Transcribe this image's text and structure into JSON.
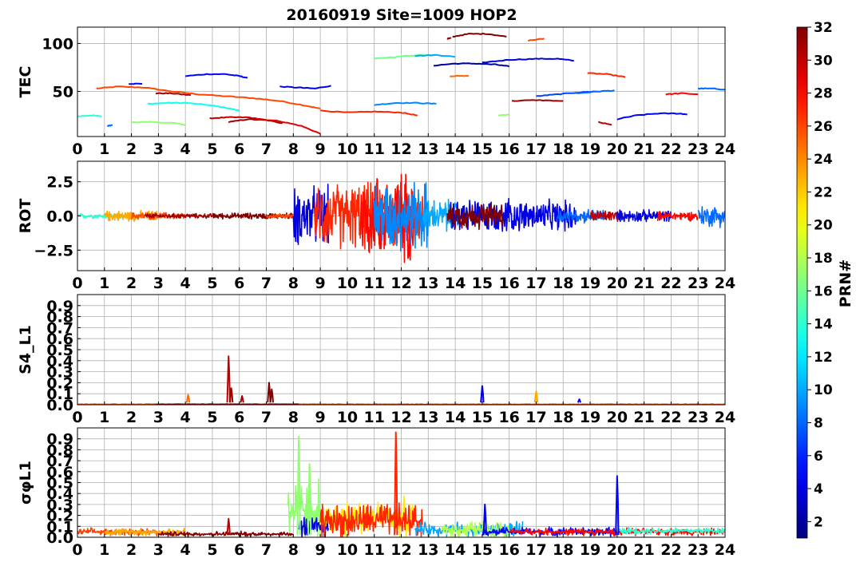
{
  "figure_title": "20160919 Site=1009 HOP2",
  "colorbar": {
    "label": "PRN#",
    "min": 1,
    "max": 32,
    "ticks": [
      2,
      4,
      6,
      8,
      10,
      12,
      14,
      16,
      18,
      20,
      22,
      24,
      26,
      28,
      30,
      32
    ],
    "colormap": "jet"
  },
  "chart_data": [
    {
      "type": "line",
      "panel": "TEC",
      "ylabel": "TEC",
      "xlim": [
        0,
        24
      ],
      "ylim": [
        3,
        117
      ],
      "yticks": [
        50,
        100
      ],
      "xticks": [
        0,
        1,
        2,
        3,
        4,
        5,
        6,
        7,
        8,
        9,
        10,
        11,
        12,
        13,
        14,
        15,
        16,
        17,
        18,
        19,
        20,
        21,
        22,
        23,
        24
      ],
      "grid": true,
      "series": [
        {
          "prn": 26,
          "x": [
            0.7,
            1.5,
            2.5,
            3.5,
            4.5,
            5.5,
            6.5,
            7.5,
            8.5,
            9.0
          ],
          "y": [
            53,
            55,
            54,
            50,
            47,
            45,
            43,
            40,
            35,
            32
          ]
        },
        {
          "prn": 13,
          "x": [
            2.6,
            3.3,
            4.0,
            4.8,
            5.5,
            6.0
          ],
          "y": [
            37,
            38,
            38,
            36,
            33,
            30
          ]
        },
        {
          "prn": 17,
          "x": [
            2.0,
            2.8,
            3.6,
            4.0
          ],
          "y": [
            18,
            18,
            17,
            15
          ]
        },
        {
          "prn": 14,
          "x": [
            0.0,
            0.5,
            0.9
          ],
          "y": [
            24,
            25,
            24
          ]
        },
        {
          "prn": 8,
          "x": [
            1.1,
            1.3
          ],
          "y": [
            14,
            15
          ]
        },
        {
          "prn": 5,
          "x": [
            1.9,
            2.4
          ],
          "y": [
            58,
            58
          ]
        },
        {
          "prn": 31,
          "x": [
            2.9,
            3.5,
            4.2
          ],
          "y": [
            48,
            48,
            46
          ]
        },
        {
          "prn": 5,
          "x": [
            4.0,
            4.8,
            5.5,
            6.0,
            6.3
          ],
          "y": [
            66,
            68,
            68,
            66,
            64
          ]
        },
        {
          "prn": 30,
          "x": [
            4.9,
            5.6,
            6.3,
            6.8
          ],
          "y": [
            22,
            23,
            23,
            21
          ]
        },
        {
          "prn": 31,
          "x": [
            5.6,
            6.3,
            7.0,
            7.6
          ],
          "y": [
            18,
            21,
            20,
            17
          ]
        },
        {
          "prn": 29,
          "x": [
            6.5,
            7.5,
            8.3,
            9.0
          ],
          "y": [
            22,
            19,
            14,
            6
          ]
        },
        {
          "prn": 4,
          "x": [
            7.5,
            8.2,
            8.8,
            9.4
          ],
          "y": [
            55,
            54,
            53,
            56
          ]
        },
        {
          "prn": 27,
          "x": [
            9.0,
            10.0,
            11.0,
            12.0,
            12.6
          ],
          "y": [
            30,
            28,
            29,
            28,
            25
          ]
        },
        {
          "prn": 16,
          "x": [
            11.0,
            11.8,
            12.6,
            13.3
          ],
          "y": [
            84,
            86,
            88,
            88
          ]
        },
        {
          "prn": 10,
          "x": [
            12.5,
            13.3,
            14.0
          ],
          "y": [
            87,
            88,
            86
          ]
        },
        {
          "prn": 9,
          "x": [
            11.0,
            11.8,
            12.6,
            13.3
          ],
          "y": [
            36,
            38,
            38,
            37
          ]
        },
        {
          "prn": 2,
          "x": [
            13.2,
            14.0,
            14.8,
            15.5,
            16.0
          ],
          "y": [
            77,
            79,
            79,
            78,
            76
          ]
        },
        {
          "prn": 4,
          "x": [
            15.0,
            16.0,
            17.0,
            17.8,
            18.4
          ],
          "y": [
            80,
            83,
            84,
            84,
            82
          ]
        },
        {
          "prn": 32,
          "x": [
            13.9,
            14.5,
            15.2,
            15.9
          ],
          "y": [
            107,
            110,
            110,
            107
          ]
        },
        {
          "prn": 31,
          "x": [
            13.7,
            13.85
          ],
          "y": [
            105,
            106
          ]
        },
        {
          "prn": 25,
          "x": [
            13.8,
            14.5
          ],
          "y": [
            66,
            66
          ]
        },
        {
          "prn": 26,
          "x": [
            16.7,
            17.3
          ],
          "y": [
            103,
            105
          ]
        },
        {
          "prn": 17,
          "x": [
            15.6,
            16.0
          ],
          "y": [
            25,
            26
          ]
        },
        {
          "prn": 31,
          "x": [
            16.1,
            17.0,
            18.0
          ],
          "y": [
            40,
            41,
            40
          ]
        },
        {
          "prn": 7,
          "x": [
            17.0,
            17.8,
            18.6,
            19.2
          ],
          "y": [
            45,
            47,
            49,
            50
          ]
        },
        {
          "prn": 8,
          "x": [
            18.5,
            19.3,
            19.9
          ],
          "y": [
            48,
            50,
            51
          ]
        },
        {
          "prn": 27,
          "x": [
            18.9,
            19.6,
            20.3
          ],
          "y": [
            69,
            68,
            65
          ]
        },
        {
          "prn": 30,
          "x": [
            19.3,
            19.8
          ],
          "y": [
            18,
            15
          ]
        },
        {
          "prn": 5,
          "x": [
            20.0,
            20.7,
            21.5,
            22.3,
            22.6
          ],
          "y": [
            21,
            25,
            27,
            27,
            26
          ]
        },
        {
          "prn": 28,
          "x": [
            21.8,
            22.4,
            23.0
          ],
          "y": [
            47,
            48,
            47
          ]
        },
        {
          "prn": 8,
          "x": [
            23.0,
            23.5,
            24.0
          ],
          "y": [
            53,
            53,
            52
          ]
        }
      ]
    },
    {
      "type": "line",
      "panel": "ROT",
      "ylabel": "ROT",
      "xlim": [
        0,
        24
      ],
      "ylim": [
        -4,
        4
      ],
      "yticks": [
        -2.5,
        0.0,
        2.5
      ],
      "ytick_labels": [
        "−2.5",
        "0.0",
        "2.5"
      ],
      "xticks": [
        0,
        1,
        2,
        3,
        4,
        5,
        6,
        7,
        8,
        9,
        10,
        11,
        12,
        13,
        14,
        15,
        16,
        17,
        18,
        19,
        20,
        21,
        22,
        23,
        24
      ],
      "grid": true,
      "envelope": [
        {
          "x0": 0.0,
          "x1": 2.0,
          "amp": 0.2,
          "prn": 14
        },
        {
          "x0": 1.0,
          "x1": 3.0,
          "amp": 0.45,
          "prn": 23
        },
        {
          "x0": 2.0,
          "x1": 4.0,
          "amp": 0.3,
          "prn": 26
        },
        {
          "x0": 2.5,
          "x1": 5.0,
          "amp": 0.2,
          "prn": 31
        },
        {
          "x0": 5.0,
          "x1": 8.0,
          "amp": 0.25,
          "prn": 32
        },
        {
          "x0": 7.0,
          "x1": 8.0,
          "amp": 0.2,
          "prn": 26
        },
        {
          "x0": 8.0,
          "x1": 9.3,
          "amp": 2.5,
          "prn": 4
        },
        {
          "x0": 8.8,
          "x1": 12.8,
          "amp": 2.8,
          "prn": 27
        },
        {
          "x0": 10.5,
          "x1": 12.5,
          "amp": 3.8,
          "prn": 28
        },
        {
          "x0": 11.0,
          "x1": 13.0,
          "amp": 3.0,
          "prn": 9
        },
        {
          "x0": 12.8,
          "x1": 14.2,
          "amp": 1.4,
          "prn": 10
        },
        {
          "x0": 13.8,
          "x1": 16.0,
          "amp": 1.4,
          "prn": 4
        },
        {
          "x0": 13.7,
          "x1": 15.8,
          "amp": 1.1,
          "prn": 32
        },
        {
          "x0": 16.0,
          "x1": 18.5,
          "amp": 1.3,
          "prn": 4
        },
        {
          "x0": 17.8,
          "x1": 19.5,
          "amp": 0.6,
          "prn": 8
        },
        {
          "x0": 19.0,
          "x1": 20.2,
          "amp": 0.5,
          "prn": 30
        },
        {
          "x0": 20.0,
          "x1": 22.0,
          "amp": 0.5,
          "prn": 4
        },
        {
          "x0": 21.5,
          "x1": 23.0,
          "amp": 0.4,
          "prn": 28
        },
        {
          "x0": 23.0,
          "x1": 24.0,
          "amp": 0.9,
          "prn": 8
        }
      ]
    },
    {
      "type": "line",
      "panel": "S4_L1",
      "ylabel": "S4_L1",
      "xlim": [
        0,
        24
      ],
      "ylim": [
        0,
        1.0
      ],
      "yticks": [
        0.0,
        0.1,
        0.2,
        0.3,
        0.4,
        0.5,
        0.6,
        0.7,
        0.8,
        0.9
      ],
      "ytick_labels": [
        "0.0",
        "0.1",
        "0.2",
        "0.3",
        "0.4",
        "0.5",
        "0.6",
        "0.7",
        "0.8",
        "0.9"
      ],
      "xticks": [
        0,
        1,
        2,
        3,
        4,
        5,
        6,
        7,
        8,
        9,
        10,
        11,
        12,
        13,
        14,
        15,
        16,
        17,
        18,
        19,
        20,
        21,
        22,
        23,
        24
      ],
      "grid": true,
      "baseline_series": [
        {
          "prn": 26,
          "x0": 0.0,
          "x1": 24.0
        },
        {
          "prn": 31,
          "x0": 2.9,
          "x1": 8.2
        }
      ],
      "spikes": [
        {
          "prn": 25,
          "x": 4.1,
          "y": 0.09
        },
        {
          "prn": 30,
          "x": 5.6,
          "y": 0.44
        },
        {
          "prn": 31,
          "x": 5.7,
          "y": 0.15
        },
        {
          "prn": 31,
          "x": 6.1,
          "y": 0.08
        },
        {
          "prn": 32,
          "x": 7.1,
          "y": 0.2
        },
        {
          "prn": 32,
          "x": 7.2,
          "y": 0.14
        },
        {
          "prn": 4,
          "x": 15.0,
          "y": 0.17
        },
        {
          "prn": 23,
          "x": 17.0,
          "y": 0.12
        },
        {
          "prn": 4,
          "x": 18.6,
          "y": 0.05
        }
      ]
    },
    {
      "type": "line",
      "panel": "sigma_phi_L1",
      "ylabel": "σφL1",
      "xlim": [
        0,
        24
      ],
      "ylim": [
        0,
        1.0
      ],
      "yticks": [
        0.0,
        0.1,
        0.2,
        0.3,
        0.4,
        0.5,
        0.6,
        0.7,
        0.8,
        0.9
      ],
      "ytick_labels": [
        "0.0",
        "0.1",
        "0.2",
        "0.3",
        "0.4",
        "0.5",
        "0.6",
        "0.7",
        "0.8",
        "0.9"
      ],
      "xticks": [
        0,
        1,
        2,
        3,
        4,
        5,
        6,
        7,
        8,
        9,
        10,
        11,
        12,
        13,
        14,
        15,
        16,
        17,
        18,
        19,
        20,
        21,
        22,
        23,
        24
      ],
      "grid": true,
      "noise": [
        {
          "x0": 0.0,
          "x1": 3.0,
          "base": 0.05,
          "amp": 0.04,
          "prn": 26
        },
        {
          "x0": 1.0,
          "x1": 4.0,
          "base": 0.05,
          "amp": 0.04,
          "prn": 23
        },
        {
          "x0": 3.0,
          "x1": 8.0,
          "base": 0.03,
          "amp": 0.03,
          "prn": 32
        },
        {
          "x0": 7.8,
          "x1": 9.0,
          "base": 0.25,
          "amp": 0.35,
          "prn": 17
        },
        {
          "x0": 8.2,
          "x1": 9.3,
          "base": 0.08,
          "amp": 0.15,
          "prn": 4
        },
        {
          "x0": 9.0,
          "x1": 12.5,
          "base": 0.18,
          "amp": 0.2,
          "prn": 21
        },
        {
          "x0": 9.0,
          "x1": 12.8,
          "base": 0.15,
          "amp": 0.2,
          "prn": 27
        },
        {
          "x0": 12.5,
          "x1": 16.5,
          "base": 0.07,
          "amp": 0.08,
          "prn": 10
        },
        {
          "x0": 13.5,
          "x1": 16.0,
          "base": 0.07,
          "amp": 0.1,
          "prn": 18
        },
        {
          "x0": 15.0,
          "x1": 20.0,
          "base": 0.05,
          "amp": 0.05,
          "prn": 5
        },
        {
          "x0": 16.0,
          "x1": 24.0,
          "base": 0.05,
          "amp": 0.04,
          "prn": 28
        },
        {
          "x0": 20.0,
          "x1": 24.0,
          "base": 0.06,
          "amp": 0.04,
          "prn": 14
        }
      ],
      "spikes": [
        {
          "prn": 17,
          "x": 8.2,
          "y": 0.92
        },
        {
          "prn": 17,
          "x": 8.6,
          "y": 0.67
        },
        {
          "prn": 27,
          "x": 11.8,
          "y": 0.96
        },
        {
          "prn": 30,
          "x": 5.6,
          "y": 0.17
        },
        {
          "prn": 4,
          "x": 15.1,
          "y": 0.3
        },
        {
          "prn": 5,
          "x": 20.0,
          "y": 0.56
        }
      ]
    }
  ]
}
